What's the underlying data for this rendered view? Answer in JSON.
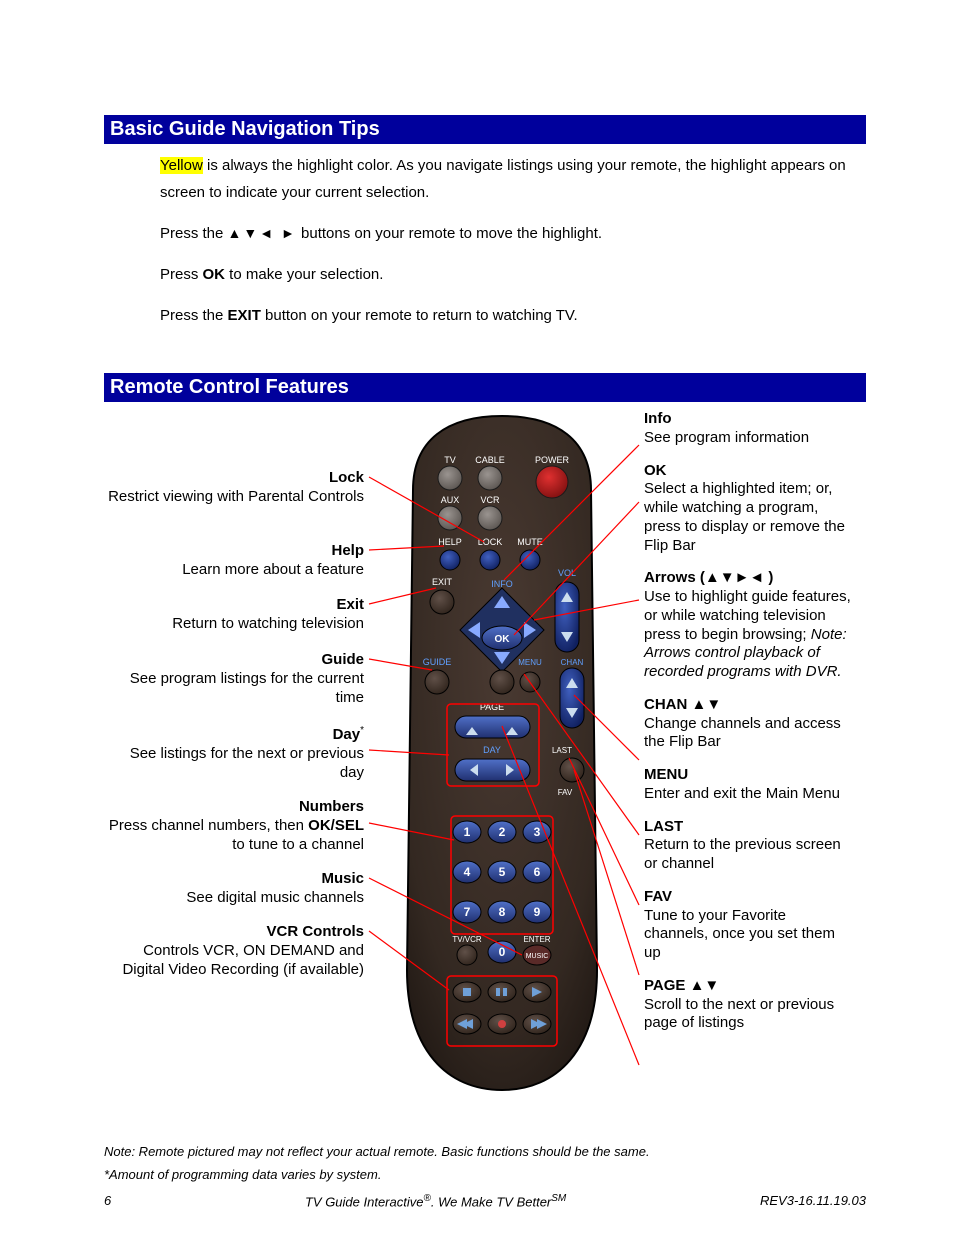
{
  "section1": {
    "title": "Basic Guide Navigation Tips",
    "p1_yellow": "Yellow",
    "p1_rest": " is always the highlight color. As you navigate listings using your remote, the highlight appears on screen to indicate your current selection.",
    "p2_pre": "Press the ",
    "p2_arrows": "▲▼◄ ►",
    "p2_post": " buttons on your remote to move the highlight.",
    "p3_pre": "Press ",
    "p3_bold": "OK",
    "p3_post": " to make your selection.",
    "p4_pre": "Press the ",
    "p4_bold": "EXIT",
    "p4_post": " button on your remote to return to watching TV."
  },
  "section2": {
    "title": "Remote Control Features"
  },
  "left": {
    "lock": {
      "label": "Lock",
      "desc": "Restrict viewing with Parental Controls"
    },
    "help": {
      "label": "Help",
      "desc": "Learn more about a feature"
    },
    "exit": {
      "label": "Exit",
      "desc": "Return to watching television"
    },
    "guide": {
      "label": "Guide",
      "desc": "See program listings for the current time"
    },
    "day": {
      "label": "Day",
      "sup": "*",
      "desc": "See listings for the next or previous day"
    },
    "numbers": {
      "label": "Numbers",
      "desc_pre": "Press channel numbers, then ",
      "desc_bold": "OK/SEL",
      "desc_post": " to tune to a channel"
    },
    "music": {
      "label": "Music",
      "desc": "See digital music channels"
    },
    "vcr": {
      "label": "VCR Controls",
      "desc": "Controls VCR, ON DEMAND and Digital Video Recording (if available)"
    }
  },
  "right": {
    "info": {
      "label": "Info",
      "desc": "See program information"
    },
    "ok": {
      "label": "OK",
      "desc": "Select a highlighted item; or, while watching a program, press to display or remove the Flip Bar"
    },
    "arrows": {
      "label_pre": "Arrows",
      "label_syms": " (▲▼►◄ )",
      "desc_pre": "Use to highlight guide features, or while watching television press to begin browsing; ",
      "desc_ital": "Note: Arrows control playback of recorded programs with DVR."
    },
    "chan": {
      "label": "CHAN ▲▼",
      "desc": "Change channels and access the Flip Bar"
    },
    "menu": {
      "label": "MENU",
      "desc": "Enter and exit the Main Menu"
    },
    "last": {
      "label": "LAST",
      "desc": "Return to the previous screen or channel"
    },
    "fav": {
      "label": "FAV",
      "desc": "Tune to your Favorite channels, once you set them up"
    },
    "page": {
      "label": "PAGE ▲▼",
      "desc": "Scroll to the next or previous page of listings"
    }
  },
  "remote": {
    "tv": "TV",
    "cable": "CABLE",
    "power": "POWER",
    "aux": "AUX",
    "vcr": "VCR",
    "help": "HELP",
    "lock": "LOCK",
    "mute": "MUTE",
    "exit": "EXIT",
    "info": "INFO",
    "vol": "VOL",
    "ok": "OK",
    "guide": "GUIDE",
    "menu": "MENU",
    "chan": "CHAN",
    "page": "PAGE",
    "last": "LAST",
    "day": "DAY",
    "fav": "FAV",
    "n1": "1",
    "n2": "2",
    "n3": "3",
    "n4": "4",
    "n5": "5",
    "n6": "6",
    "n7": "7",
    "n8": "8",
    "n9": "9",
    "n0": "0",
    "tvvcr": "TV/VCR",
    "enter": "ENTER",
    "music": "MUSIC"
  },
  "notes": {
    "note1": "Note: Remote pictured may not reflect your actual remote.  Basic functions should be the same.",
    "note2": "*Amount of programming data varies by system."
  },
  "footer": {
    "pagenum": "6",
    "center_pre": "TV Guide Interactive",
    "center_sup1": "®",
    "center_mid": ". We Make TV Better",
    "center_sup2": "SM",
    "rev": "REV3-16.11.19.03"
  }
}
